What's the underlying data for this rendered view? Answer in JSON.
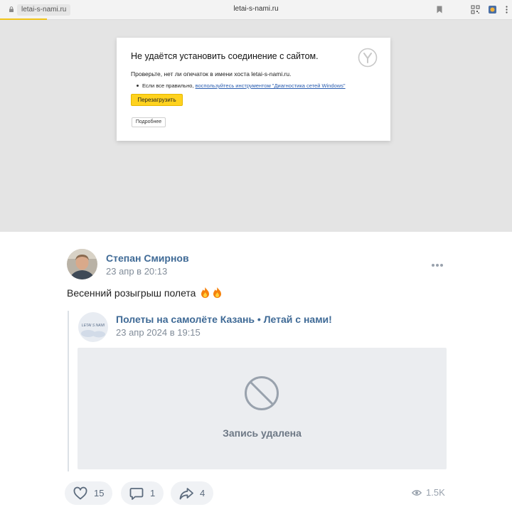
{
  "browser": {
    "tab_url": "letai-s-nami.ru",
    "address": "letai-s-nami.ru"
  },
  "error_page": {
    "title": "Не удаётся установить соединение с сайтом.",
    "subtitle": "Проверьте, нет ли опечаток в имени хоста letai-s-nami.ru.",
    "bullet_prefix": "Если все правильно,",
    "bullet_link": "воспользуйтесь инструментом \"Диагностика сетей Windows\"",
    "reload_label": "Перезагрузить",
    "more_label": "Подробнее"
  },
  "post": {
    "author": "Степан Смирнов",
    "date": "23 апр в 20:13",
    "text": "Весенний розыгрыш полета",
    "repost": {
      "group_name": "Полеты на самолёте Казань • Летай с нами!",
      "group_avatar_text": "LETAI S NAMI",
      "date": "23 апр 2024 в 19:15",
      "deleted_text": "Запись удалена"
    },
    "actions": {
      "likes": "15",
      "comments": "1",
      "shares": "4",
      "views": "1.5K"
    }
  },
  "colors": {
    "accent_link": "#3f6a96",
    "reload_button": "#ffd21e",
    "action_bg": "#f0f2f5"
  }
}
